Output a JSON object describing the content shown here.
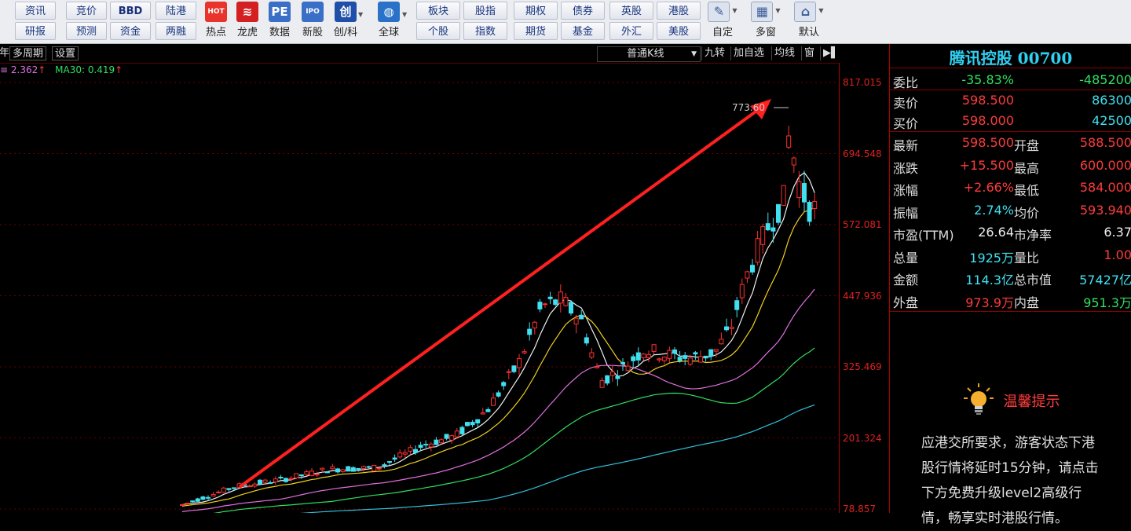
{
  "toolbar": {
    "row1_buttons": [
      "资讯",
      "竞价",
      "BBD",
      "陆港"
    ],
    "row2_buttons": [
      "研报",
      "预测",
      "资金",
      "两融"
    ],
    "icons": [
      {
        "name": "hot-icon",
        "label": "热点",
        "glyph": "HOT",
        "color": "#e8342a"
      },
      {
        "name": "longhu-icon",
        "label": "龙虎",
        "glyph": "≋",
        "color": "#d42020"
      },
      {
        "name": "data-icon",
        "label": "数据",
        "glyph": "PE",
        "color": "#3a6fc8"
      },
      {
        "name": "ipo-icon",
        "label": "新股",
        "glyph": "IPO",
        "color": "#3a6fc8"
      },
      {
        "name": "chuang-icon",
        "label": "创/科",
        "glyph": "创",
        "color": "#1f4fa8"
      },
      {
        "name": "globe-icon",
        "label": "全球",
        "glyph": "◍",
        "color": "#2a72c8"
      }
    ],
    "grid_row1": [
      "板块",
      "股指",
      "期权",
      "债券",
      "英股",
      "港股"
    ],
    "grid_row2": [
      "个股",
      "指数",
      "期货",
      "基金",
      "外汇",
      "美股"
    ],
    "right_icons": [
      {
        "name": "custom-icon",
        "label": "自定"
      },
      {
        "name": "multi-window-icon",
        "label": "多窗"
      },
      {
        "name": "home-icon",
        "label": "默认"
      }
    ]
  },
  "chart_header": {
    "tabs": [
      "年",
      "多周期",
      "设置"
    ],
    "kline_type": "普通K线",
    "controls": [
      "九转",
      "加自选",
      "均线",
      "窗"
    ],
    "ma_text_a": "2.362",
    "ma_text_b": "MA30: 0.419",
    "peak_label": "773.60"
  },
  "price_axis": [
    "817.015",
    "694.548",
    "572.081",
    "447.936",
    "325.469",
    "201.324",
    "78.857"
  ],
  "quote": {
    "title": "腾讯控股 00700",
    "weibi": {
      "label": "委比",
      "v1": "-35.83%",
      "v2": "-485200"
    },
    "sell": {
      "label": "卖价",
      "v1": "598.500",
      "v2": "86300"
    },
    "buy": {
      "label": "买价",
      "v1": "598.000",
      "v2": "42500"
    },
    "rows": [
      {
        "l1": "最新",
        "v1": "598.500",
        "l2": "开盘",
        "v2": "588.500"
      },
      {
        "l1": "涨跌",
        "v1": "+15.500",
        "l2": "最高",
        "v2": "600.000"
      },
      {
        "l1": "涨幅",
        "v1": "+2.66%",
        "l2": "最低",
        "v2": "584.000"
      },
      {
        "l1": "振幅",
        "v1": "2.74%",
        "l2": "均价",
        "v2": "593.940"
      },
      {
        "l1": "市盈(TTM)",
        "v1": "26.64",
        "l2": "市净率",
        "v2": "6.37"
      },
      {
        "l1": "总量",
        "v1": "1925万",
        "l2": "量比",
        "v2": "1.00"
      },
      {
        "l1": "金额",
        "v1": "114.3亿",
        "l2": "总市值",
        "v2": "57427亿"
      },
      {
        "l1": "外盘",
        "v1": "973.9万",
        "l2": "内盘",
        "v2": "951.3万"
      }
    ]
  },
  "tips": {
    "title": "温馨提示",
    "body": "应港交所要求，游客状态下港股行情将延时15分钟，请点击下方免费升级level2高级行情，畅享实时港股行情。"
  }
}
